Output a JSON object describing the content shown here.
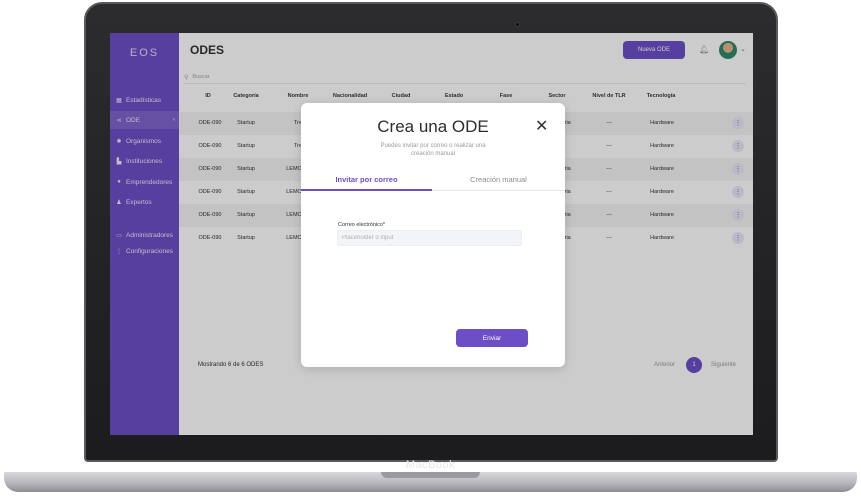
{
  "device": {
    "brand": "MacBook"
  },
  "sidebar": {
    "logo": "EOS",
    "accent": "#6c4fc6",
    "items": [
      {
        "label": "Estadísticas",
        "icon": "chart-icon"
      },
      {
        "label": "ODE",
        "icon": "share-icon",
        "chevron": "‹"
      },
      {
        "label": "Organismos",
        "icon": "cog-icon"
      },
      {
        "label": "Instituciones",
        "icon": "building-icon"
      },
      {
        "label": "Emprendedores",
        "icon": "user-circle-icon"
      },
      {
        "label": "Expertos",
        "icon": "user-icon"
      },
      {
        "label": "Administradores",
        "icon": "id-card-icon"
      },
      {
        "label": "Configuraciones",
        "icon": "more-vertical-icon"
      }
    ]
  },
  "header": {
    "title": "ODES",
    "new_button": "Nueva ODE"
  },
  "search": {
    "placeholder": "Buscar"
  },
  "table": {
    "columns": [
      "ID",
      "Categoría",
      "Nombre",
      "Nacionalidad",
      "Ciudad",
      "Estado",
      "Fase",
      "Sector",
      "Nivel de TLR",
      "Tecnología"
    ],
    "rows": [
      {
        "id": "ODE-090",
        "categoria": "Startup",
        "nombre": "Tre",
        "sector": "ustria",
        "nivel": "---",
        "tecnologia": "Hardware"
      },
      {
        "id": "ODE-090",
        "categoria": "Startup",
        "nombre": "Tre",
        "sector": "",
        "nivel": "---",
        "tecnologia": "Hardware"
      },
      {
        "id": "ODE-090",
        "categoria": "Startup",
        "nombre": "LEMONC",
        "sector": "ustria",
        "nivel": "---",
        "tecnologia": "Hardware"
      },
      {
        "id": "ODE-090",
        "categoria": "Startup",
        "nombre": "LEMONC",
        "sector": "ustria",
        "nivel": "---",
        "tecnologia": "Hardware"
      },
      {
        "id": "ODE-090",
        "categoria": "Startup",
        "nombre": "LEMONC",
        "sector": "ustria",
        "nivel": "---",
        "tecnologia": "Hardware"
      },
      {
        "id": "ODE-090",
        "categoria": "Startup",
        "nombre": "LEMONC",
        "sector": "ustria",
        "nivel": "---",
        "tecnologia": "Hardware"
      }
    ]
  },
  "footer": {
    "showing": "Mostrando 6 de 6 ODES",
    "prev": "Anterior",
    "page": "1",
    "next": "Siguiente"
  },
  "modal": {
    "title": "Crea una ODE",
    "close": "✕",
    "subtitle": "Puedes invitar por correo o realizar una creación manual",
    "tabs": [
      {
        "label": "Invitar por correo",
        "active": true
      },
      {
        "label": "Creación manual",
        "active": false
      }
    ],
    "email_label": "Correo electrónico*",
    "email_value": "",
    "email_placeholder": "Placeholder o input",
    "submit": "Enviar"
  }
}
